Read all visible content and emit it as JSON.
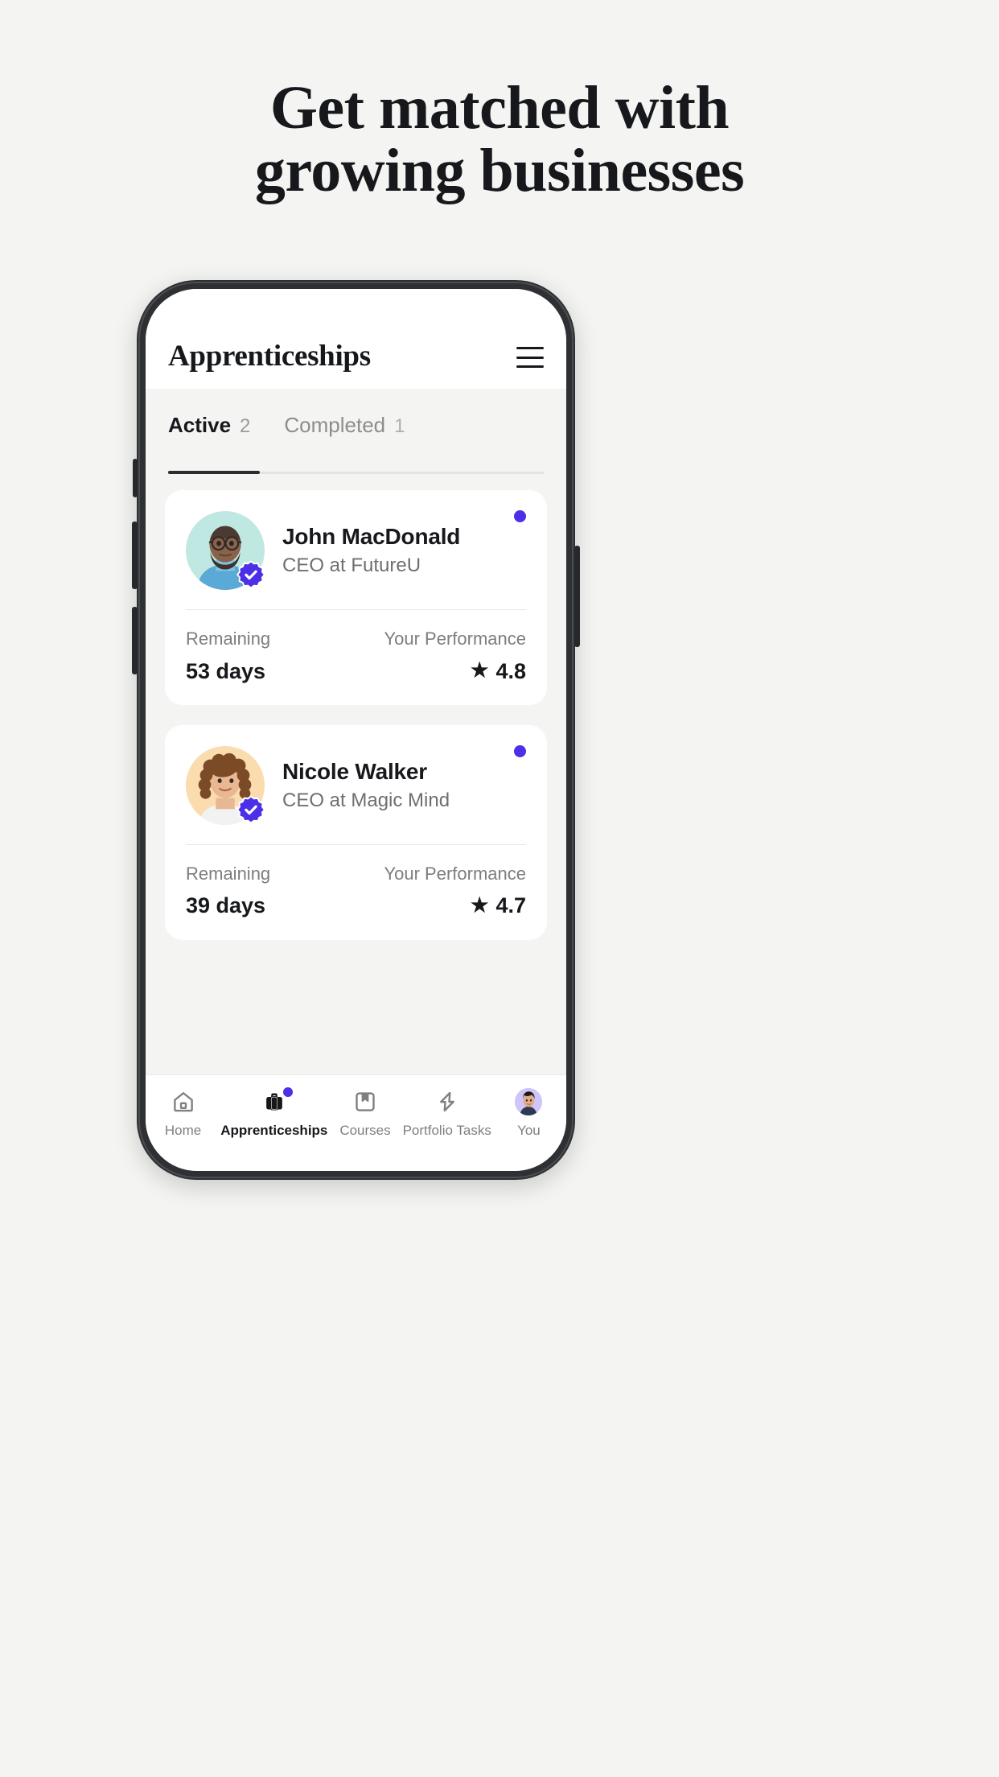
{
  "headline": {
    "line1": "Get matched with",
    "line2": "growing businesses"
  },
  "app": {
    "title": "Apprenticeships",
    "menu_icon": "hamburger-icon"
  },
  "tabs": [
    {
      "label": "Active",
      "count": "2",
      "active": true
    },
    {
      "label": "Completed",
      "count": "1",
      "active": false
    }
  ],
  "cards": [
    {
      "name": "John MacDonald",
      "role": "CEO at FutureU",
      "verified": true,
      "unread": true,
      "avatar_bg": "#bfe8e3",
      "remaining_label": "Remaining",
      "remaining_value": "53 days",
      "performance_label": "Your Performance",
      "performance_value": "4.8",
      "star_icon": "star-icon"
    },
    {
      "name": "Nicole Walker",
      "role": "CEO at Magic Mind",
      "verified": true,
      "unread": true,
      "avatar_bg": "#fbdcae",
      "remaining_label": "Remaining",
      "remaining_value": "39 days",
      "performance_label": "Your Performance",
      "performance_value": "4.7",
      "star_icon": "star-icon"
    }
  ],
  "bottom_nav": [
    {
      "label": "Home",
      "icon": "home-icon",
      "active": false,
      "badge": false
    },
    {
      "label": "Apprenticeships",
      "icon": "briefcase-icon",
      "active": true,
      "badge": true
    },
    {
      "label": "Courses",
      "icon": "bookmark-square-icon",
      "active": false,
      "badge": false
    },
    {
      "label": "Portfolio Tasks",
      "icon": "lightning-bolt-icon",
      "active": false,
      "badge": false
    },
    {
      "label": "You",
      "icon": "profile-avatar-icon",
      "active": false,
      "badge": false
    }
  ],
  "colors": {
    "accent_purple": "#4b30e8",
    "page_bg": "#f4f4f2",
    "card_bg": "#ffffff",
    "text_primary": "#16181c",
    "text_muted": "#7d7d80"
  }
}
